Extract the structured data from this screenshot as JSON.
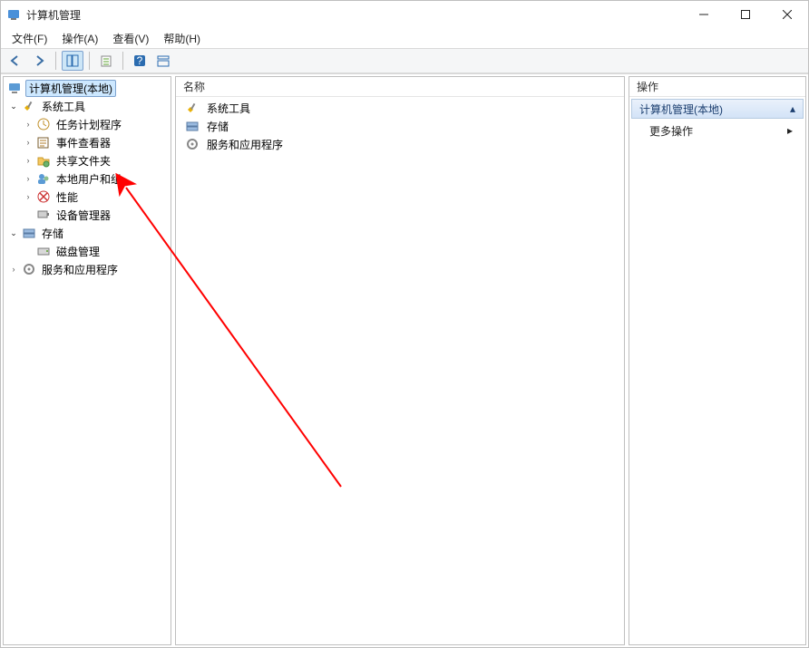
{
  "window": {
    "title": "计算机管理"
  },
  "menu": {
    "file": "文件(F)",
    "action": "操作(A)",
    "view": "查看(V)",
    "help": "帮助(H)"
  },
  "tree": {
    "root": "计算机管理(本地)",
    "sys_tools": "系统工具",
    "task_scheduler": "任务计划程序",
    "event_viewer": "事件查看器",
    "shared_folders": "共享文件夹",
    "local_users": "本地用户和组",
    "performance": "性能",
    "device_manager": "设备管理器",
    "storage": "存储",
    "disk_mgmt": "磁盘管理",
    "services_apps": "服务和应用程序"
  },
  "center": {
    "column_name": "名称",
    "item_sys_tools": "系统工具",
    "item_storage": "存储",
    "item_services_apps": "服务和应用程序"
  },
  "actions": {
    "header": "操作",
    "section": "计算机管理(本地)",
    "more": "更多操作"
  }
}
